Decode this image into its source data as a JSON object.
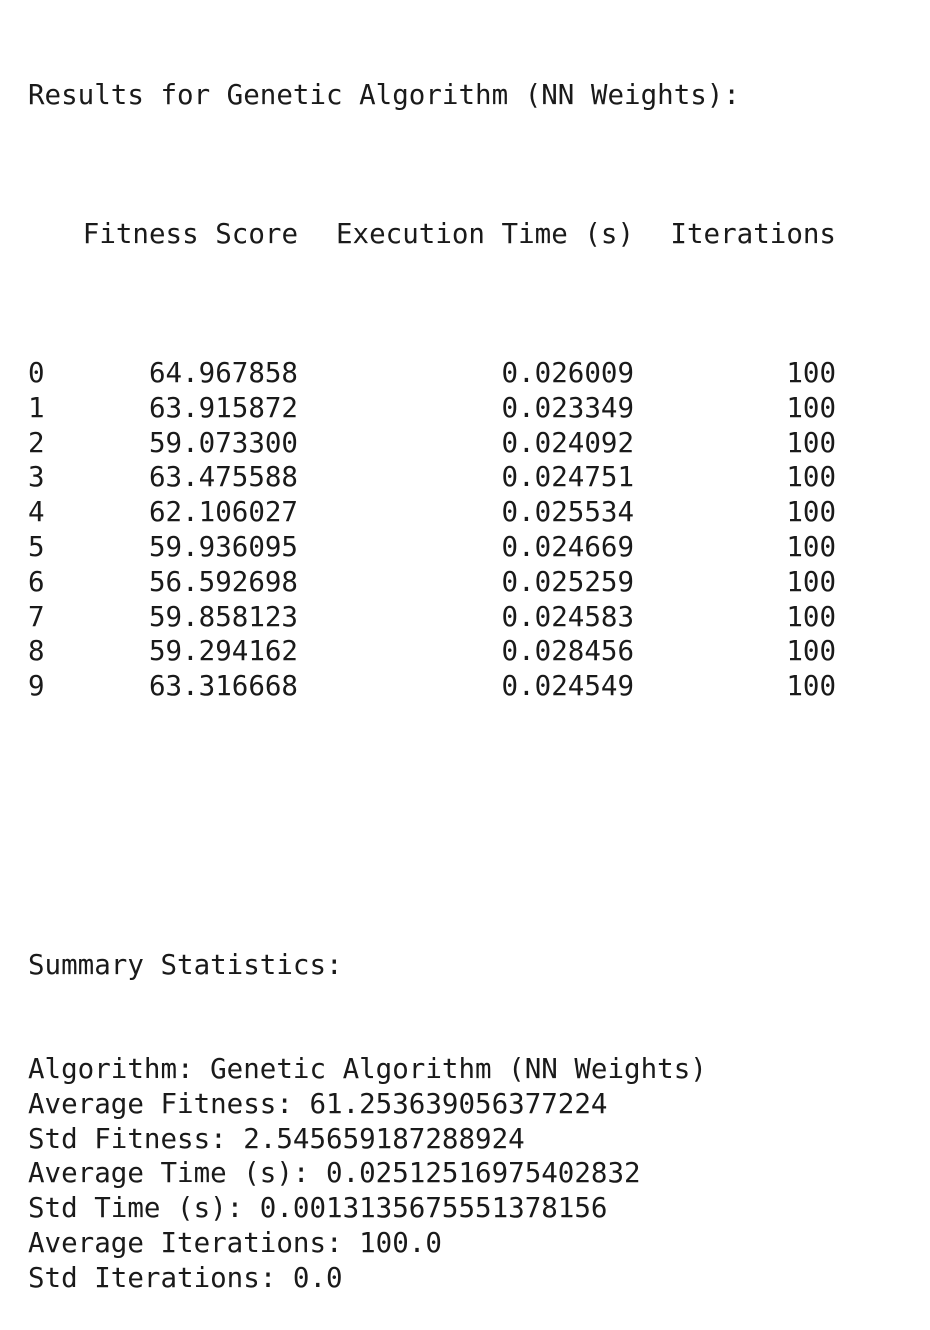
{
  "results_title": "Results for Genetic Algorithm (NN Weights):",
  "table": {
    "headers": [
      "Fitness Score",
      "Execution Time (s)",
      "Iterations"
    ],
    "rows": [
      {
        "index": "0",
        "fitness": "64.967858",
        "time": "0.026009",
        "iterations": "100"
      },
      {
        "index": "1",
        "fitness": "63.915872",
        "time": "0.023349",
        "iterations": "100"
      },
      {
        "index": "2",
        "fitness": "59.073300",
        "time": "0.024092",
        "iterations": "100"
      },
      {
        "index": "3",
        "fitness": "63.475588",
        "time": "0.024751",
        "iterations": "100"
      },
      {
        "index": "4",
        "fitness": "62.106027",
        "time": "0.025534",
        "iterations": "100"
      },
      {
        "index": "5",
        "fitness": "59.936095",
        "time": "0.024669",
        "iterations": "100"
      },
      {
        "index": "6",
        "fitness": "56.592698",
        "time": "0.025259",
        "iterations": "100"
      },
      {
        "index": "7",
        "fitness": "59.858123",
        "time": "0.024583",
        "iterations": "100"
      },
      {
        "index": "8",
        "fitness": "59.294162",
        "time": "0.028456",
        "iterations": "100"
      },
      {
        "index": "9",
        "fitness": "63.316668",
        "time": "0.024549",
        "iterations": "100"
      }
    ]
  },
  "summary": {
    "heading": "Summary Statistics:",
    "lines": [
      "Algorithm: Genetic Algorithm (NN Weights)",
      "Average Fitness: 61.253639056377224",
      "Std Fitness: 2.545659187288924",
      "Average Time (s): 0.02512516975402832",
      "Std Time (s): 0.0013135675551378156",
      "Average Iterations: 100.0",
      "Std Iterations: 0.0"
    ]
  }
}
